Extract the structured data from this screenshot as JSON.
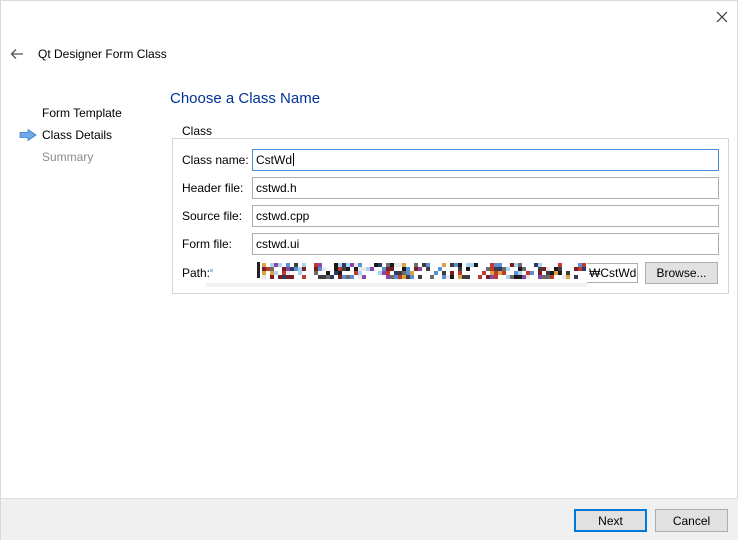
{
  "window": {
    "title": "Qt Designer Form Class",
    "close_icon": "close-icon",
    "back_icon": "back-arrow-icon"
  },
  "steps": [
    {
      "label": "Form Template",
      "state": "done"
    },
    {
      "label": "Class Details",
      "state": "current"
    },
    {
      "label": "Summary",
      "state": "pending"
    }
  ],
  "page": {
    "heading": "Choose a Class Name"
  },
  "group": {
    "title": "Class",
    "class_name_label": "Class name:",
    "class_name_value": "CstWd",
    "header_file_label": "Header file:",
    "header_file_value": "cstwd.h",
    "source_file_label": "Source file:",
    "source_file_value": "cstwd.cpp",
    "form_file_label": "Form file:",
    "form_file_value": "cstwd.ui",
    "path_label": "Path:",
    "path_suffix": "₩CstWd",
    "browse_label": "Browse..."
  },
  "footer": {
    "next_label": "Next",
    "cancel_label": "Cancel"
  },
  "colors": {
    "heading": "#003399",
    "accent": "#0078d7",
    "arrow": "#4a90e2",
    "pending": "#8c8c8c"
  }
}
